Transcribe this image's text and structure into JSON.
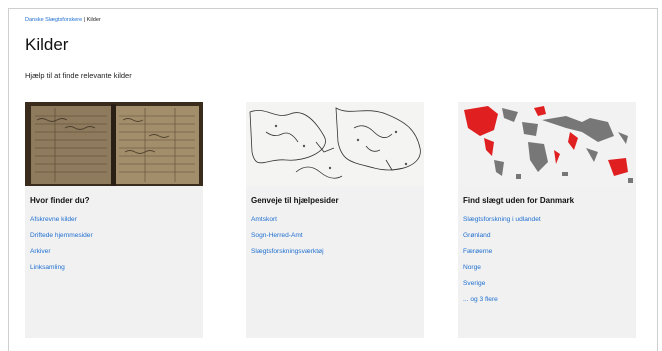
{
  "breadcrumb": {
    "home": "Danske Slægtsforskere",
    "separator": " | ",
    "current": "Kilder"
  },
  "page": {
    "title": "Kilder",
    "intro": "Hjælp til at finde relevante kilder"
  },
  "cards": [
    {
      "title": "Hvor finder du?",
      "image_icon": "old-ledger-image",
      "links": [
        "Afskrevne kilder",
        "Driftede hjemmesider",
        "Arkiver",
        "Linksamling"
      ]
    },
    {
      "title": "Genveje til hjælpesider",
      "image_icon": "old-map-image",
      "links": [
        "Amtskort",
        "Sogn-Herred-Amt",
        "Slægtsforskningsværktøj"
      ]
    },
    {
      "title": "Find slægt uden for Danmark",
      "image_icon": "world-map-image",
      "links": [
        "Slægtsforskning i udlandet",
        "Grønland",
        "Færøerne",
        "Norge",
        "Sverige",
        "... og 3 flere"
      ]
    }
  ],
  "colors": {
    "link": "#1f6fd1",
    "card_bg": "#f1f1f1",
    "map_highlight": "#e02020"
  }
}
